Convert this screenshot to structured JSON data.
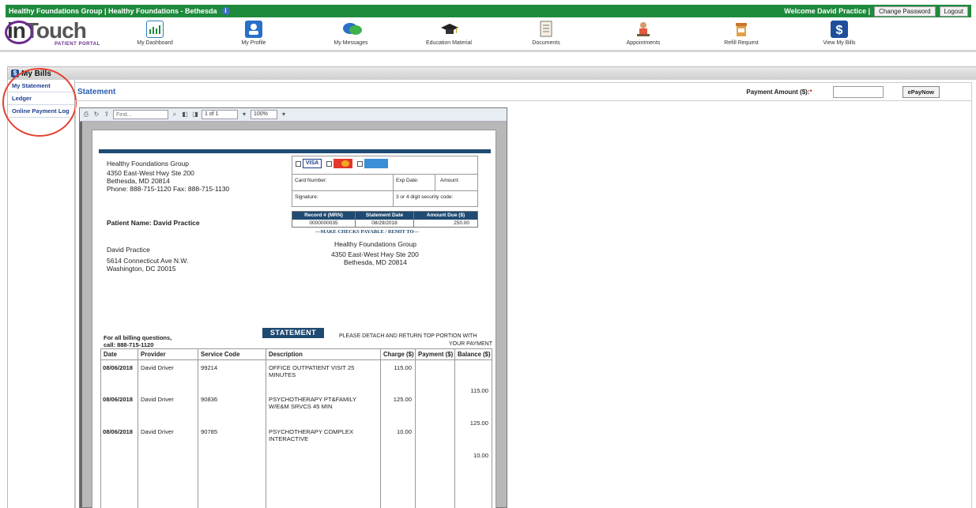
{
  "topbar": {
    "org": "Healthy Foundations Group  |  Healthy Foundations - Bethesda",
    "welcome": "Welcome David Practice |",
    "change_password": "Change Password",
    "logout": "Logout"
  },
  "logo": {
    "brand_in": "in",
    "brand_touch": "Touch",
    "sub": "PATIENT PORTAL"
  },
  "nav": [
    {
      "label": "My Dashboard"
    },
    {
      "label": "My Profile"
    },
    {
      "label": "My Messages"
    },
    {
      "label": "Education Material"
    },
    {
      "label": "Documents"
    },
    {
      "label": "Appointments"
    },
    {
      "label": "Refill Request"
    },
    {
      "label": "View My Bills"
    }
  ],
  "bills": {
    "title": "My Bills"
  },
  "sidebar": {
    "items": [
      {
        "label": "My Statement"
      },
      {
        "label": "Ledger"
      },
      {
        "label": "Online Payment Log"
      }
    ]
  },
  "statement_header": {
    "title": "Statement",
    "pay_label": "Payment Amount ($):",
    "required": "*",
    "pay_value": "",
    "epay_label": "ePayNow"
  },
  "viewer": {
    "find_placeholder": "Find...",
    "page_indicator": "1 of 1",
    "zoom": "100%"
  },
  "statement": {
    "practice_name": "Healthy Foundations Group",
    "practice_addr1": "4350 East-West Hwy Ste 200",
    "practice_addr2": "Bethesda, MD 20814",
    "practice_phone": "Phone: 888-715-1120 Fax: 888-715-1130",
    "patient_name": "Patient Name: David Practice",
    "card": {
      "visa": "VISA",
      "card_number": "Card Number:",
      "exp_date": "Exp Date:",
      "amount": "Amount:",
      "signature": "Signature:",
      "security": "3 or 4 digit security code:"
    },
    "record_headers": [
      "Record # (MRN)",
      "Statement Date",
      "Amount Due ($)"
    ],
    "record_values": [
      "0000000035",
      "08/29/2018",
      "250.00"
    ],
    "make_checks": "---MAKE CHECKS PAYABLE / REMIT TO---",
    "remit_name": "Healthy Foundations Group",
    "remit_addr1": "4350 East-West Hwy Ste 200",
    "remit_addr2": "Bethesda, MD 20814",
    "patient_addr_name": "David Practice",
    "patient_addr1": "5614 Connecticut Ave N.W.",
    "patient_addr2": "Washington, DC 20015",
    "billing_q1": "For all billing questions,",
    "billing_q2": "call: 888-715-1120",
    "detach1": "PLEASE DETACH AND RETURN TOP PORTION WITH",
    "detach2": "YOUR PAYMENT",
    "banner": "STATEMENT",
    "table_headers": [
      "Date",
      "Provider",
      "Service Code",
      "Description",
      "Charge ($)",
      "Payment ($)",
      "Balance ($)"
    ],
    "rows": [
      {
        "date": "08/06/2018",
        "provider": "David Driver",
        "code": "99214",
        "desc": "OFFICE OUTPATIENT VISIT 25 MINUTES",
        "charge": "115.00",
        "balance": "115.00"
      },
      {
        "date": "08/06/2018",
        "provider": "David Driver",
        "code": "90836",
        "desc": "PSYCHOTHERAPY PT&FAMILY W/E&M SRVCS 45 MIN",
        "charge": "125.00",
        "balance": "125.00"
      },
      {
        "date": "08/06/2018",
        "provider": "David Driver",
        "code": "90785",
        "desc": "PSYCHOTHERAPY COMPLEX INTERACTIVE",
        "charge": "10.00",
        "balance": "10.00"
      }
    ]
  },
  "colors": {
    "topbar": "#1e8a3c",
    "statement_blue": "#1f4a72",
    "link_blue": "#1f3f8f",
    "annotation_red": "#e4412f"
  }
}
